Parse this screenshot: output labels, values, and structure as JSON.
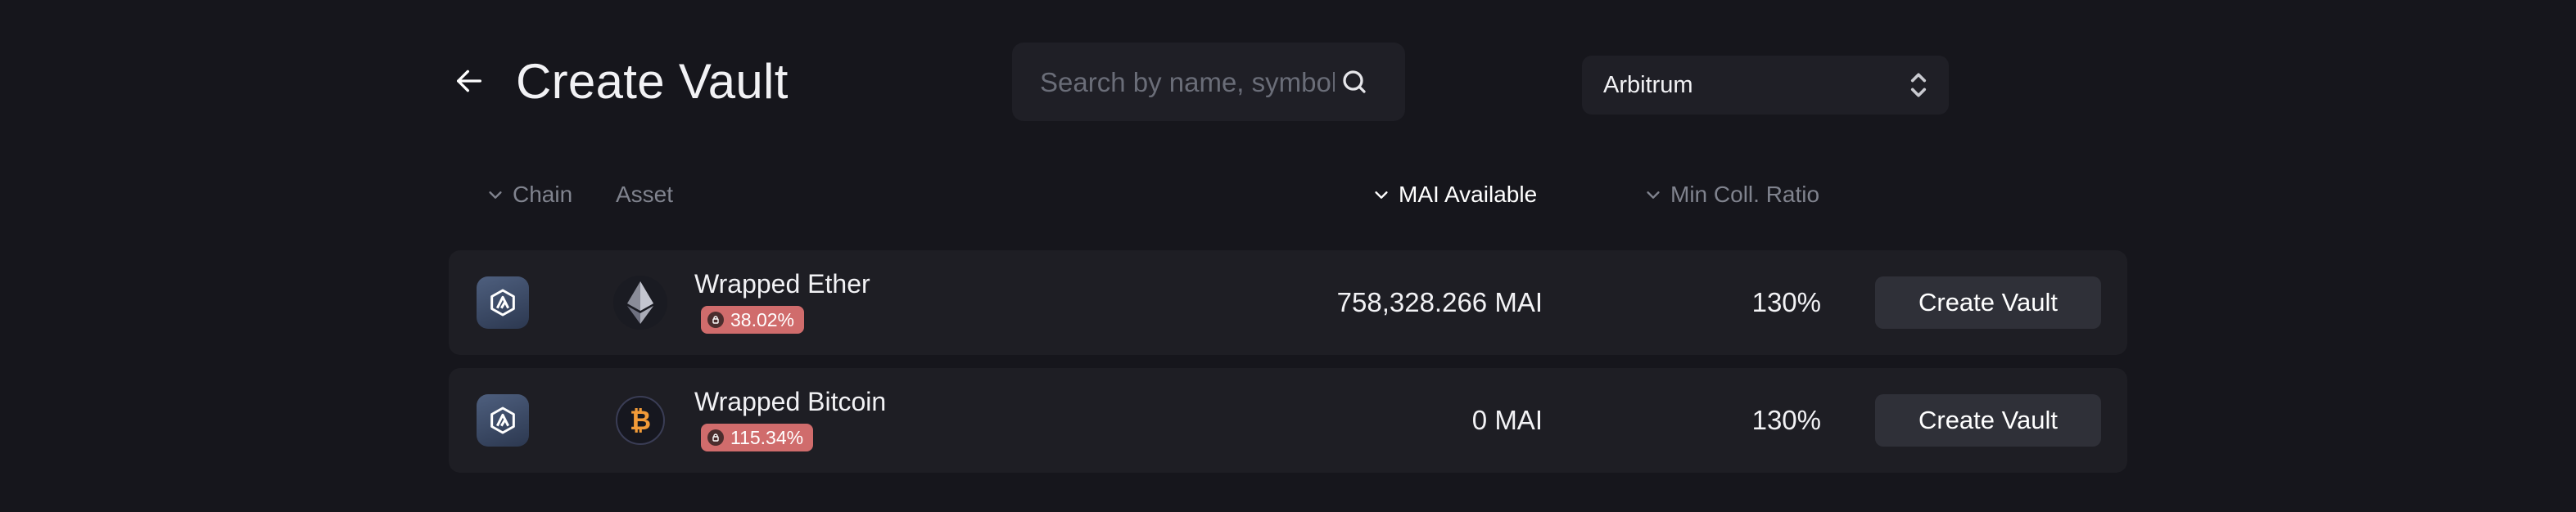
{
  "header": {
    "title": "Create Vault",
    "back_icon": "arrow-left-icon"
  },
  "search": {
    "placeholder": "Search by name, symbol",
    "value": "",
    "icon": "search-icon"
  },
  "network": {
    "selected": "Arbitrum",
    "icon": "updown-chevron-icon"
  },
  "columns": {
    "chain": "Chain",
    "asset": "Asset",
    "mai_available": "MAI Available",
    "min_coll_ratio": "Min Coll. Ratio"
  },
  "vaults": [
    {
      "chain_icon": "arbitrum-icon",
      "asset_icon": "ethereum-icon",
      "asset_name": "Wrapped Ether",
      "badge": "38.02%",
      "mai_available": "758,328.266 MAI",
      "min_coll_ratio": "130%",
      "action": "Create Vault"
    },
    {
      "chain_icon": "arbitrum-icon",
      "asset_icon": "bitcoin-icon",
      "asset_name": "Wrapped Bitcoin",
      "badge": "115.34%",
      "mai_available": "0 MAI",
      "min_coll_ratio": "130%",
      "action": "Create Vault"
    }
  ],
  "colors": {
    "background": "#16161c",
    "row": "#1e1e24",
    "badge": "#d06c6c",
    "button": "#2f3038"
  }
}
